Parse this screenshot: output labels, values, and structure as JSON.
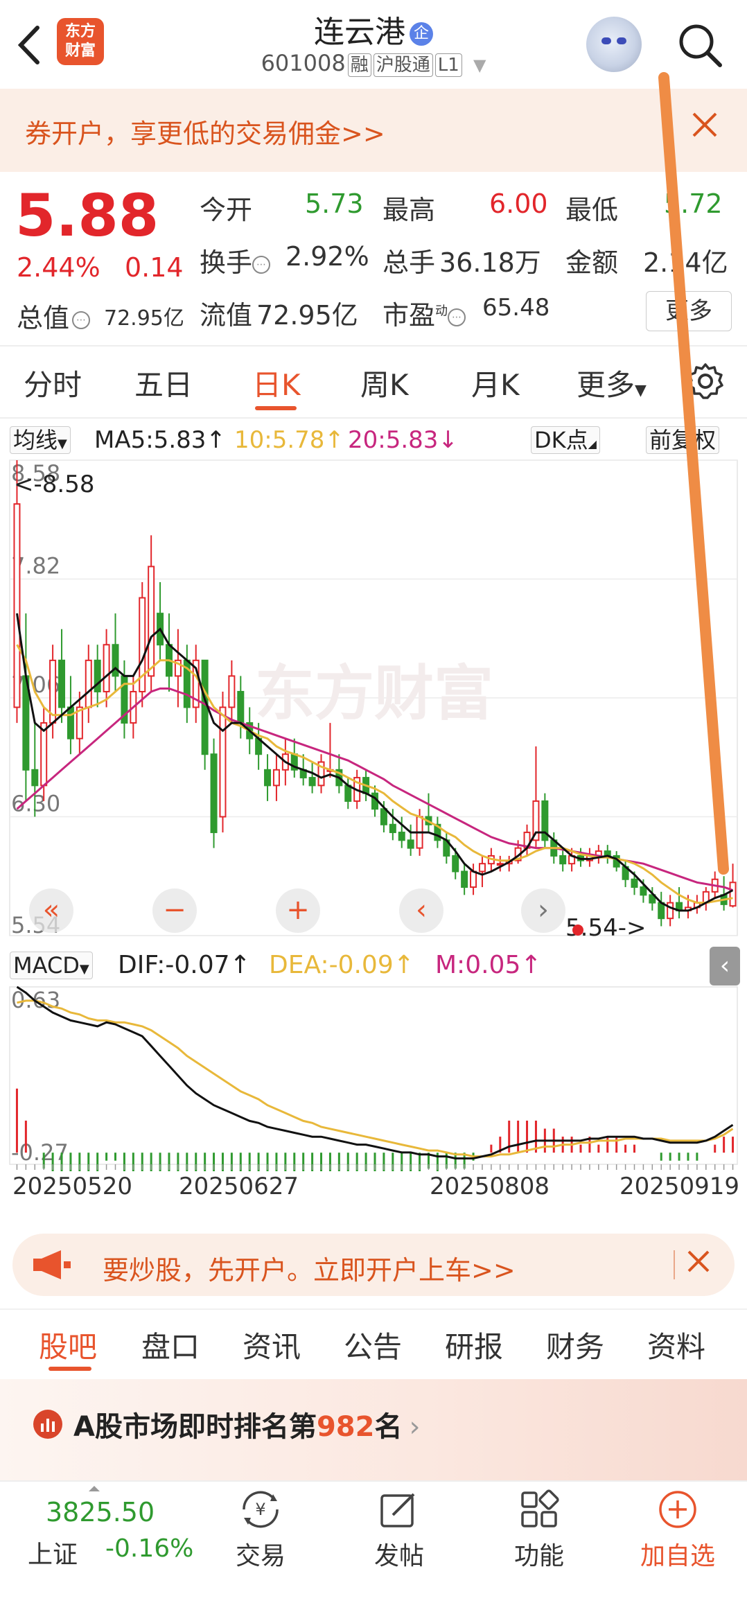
{
  "header": {
    "title": "连云港",
    "badge": "企",
    "code": "601008",
    "tags": [
      "融",
      "沪股通",
      "L1"
    ],
    "logo_text": "东方财富"
  },
  "promo": {
    "text": "券开户，享更低的交易佣金>>"
  },
  "quote": {
    "price": "5.88",
    "change_pct": "2.44%",
    "change": "0.14",
    "market_cap_label": "总值",
    "market_cap": "72.95亿",
    "rows": [
      [
        {
          "label": "今开",
          "value": "5.73",
          "color": "green"
        },
        {
          "label": "最高",
          "value": "6.00",
          "color": "red"
        },
        {
          "label": "最低",
          "value": "5.72",
          "color": "green"
        }
      ],
      [
        {
          "label": "换手",
          "value": "2.92%",
          "color": "dark"
        },
        {
          "label": "总手",
          "value": "36.18万",
          "color": "dark"
        },
        {
          "label": "金额",
          "value": "2.14亿",
          "color": "dark"
        }
      ],
      [
        {
          "label": "流值",
          "value": "72.95亿",
          "color": "dark"
        },
        {
          "label": "市盈",
          "value": "65.48",
          "color": "dark"
        }
      ]
    ],
    "pe_sup": "动",
    "more": "更多"
  },
  "ktabs": [
    "分时",
    "五日",
    "日K",
    "周K",
    "月K",
    "更多"
  ],
  "ktabs_active": 2,
  "ma": {
    "selector": "均线",
    "ma5": "MA5:5.83↑",
    "ma10": "10:5.78↑",
    "ma20": "20:5.83↓",
    "dk": "DK点",
    "fq": "前复权"
  },
  "macd": {
    "selector": "MACD",
    "dif": "DIF:-0.07↑",
    "dea": "DEA:-0.09↑",
    "m": "M:0.05↑"
  },
  "colors": {
    "accent": "#e8542d",
    "up": "#e2262b",
    "down": "#2f9a2f",
    "ma10": "#e8b83a",
    "ma20": "#c7267e",
    "ma5": "#111111"
  },
  "chart_data": [
    {
      "type": "candlestick",
      "title": "日K",
      "ylim": [
        5.54,
        8.58
      ],
      "y_ticks": [
        "8.58",
        "7.82",
        "7.06",
        "6.30",
        "5.54"
      ],
      "high_marker": "<-8.58",
      "low_marker": "5.54->",
      "x_labels": [
        "20250520",
        "20250627",
        "20250808",
        "20250919"
      ],
      "ohlc": [
        [
          7.0,
          8.58,
          6.9,
          8.3
        ],
        [
          7.2,
          7.6,
          6.4,
          6.6
        ],
        [
          6.6,
          6.9,
          6.3,
          6.5
        ],
        [
          6.5,
          7.0,
          6.4,
          6.9
        ],
        [
          6.9,
          7.4,
          6.8,
          7.3
        ],
        [
          7.3,
          7.5,
          6.9,
          7.0
        ],
        [
          7.0,
          7.2,
          6.7,
          6.8
        ],
        [
          6.8,
          7.1,
          6.7,
          7.0
        ],
        [
          7.0,
          7.4,
          6.9,
          7.3
        ],
        [
          7.3,
          7.4,
          7.0,
          7.1
        ],
        [
          7.1,
          7.5,
          7.0,
          7.4
        ],
        [
          7.4,
          7.6,
          7.1,
          7.2
        ],
        [
          7.2,
          7.3,
          6.8,
          6.9
        ],
        [
          6.9,
          7.2,
          6.8,
          7.1
        ],
        [
          7.1,
          7.8,
          7.0,
          7.7
        ],
        [
          7.2,
          8.1,
          7.1,
          7.9
        ],
        [
          7.6,
          7.8,
          7.3,
          7.4
        ],
        [
          7.4,
          7.6,
          7.1,
          7.2
        ],
        [
          7.2,
          7.5,
          7.0,
          7.3
        ],
        [
          7.3,
          7.4,
          6.9,
          7.0
        ],
        [
          7.0,
          7.4,
          6.9,
          7.3
        ],
        [
          7.3,
          7.3,
          6.6,
          6.7
        ],
        [
          6.7,
          6.8,
          6.1,
          6.2
        ],
        [
          6.3,
          7.1,
          6.2,
          7.0
        ],
        [
          7.0,
          7.3,
          6.9,
          7.2
        ],
        [
          7.1,
          7.2,
          6.8,
          6.9
        ],
        [
          6.9,
          7.0,
          6.7,
          6.8
        ],
        [
          6.8,
          6.9,
          6.6,
          6.7
        ],
        [
          6.6,
          6.7,
          6.4,
          6.5
        ],
        [
          6.5,
          6.7,
          6.4,
          6.6
        ],
        [
          6.6,
          6.8,
          6.5,
          6.7
        ],
        [
          6.7,
          6.8,
          6.55,
          6.6
        ],
        [
          6.6,
          6.7,
          6.5,
          6.55
        ],
        [
          6.55,
          6.65,
          6.45,
          6.5
        ],
        [
          6.5,
          6.7,
          6.45,
          6.65
        ],
        [
          6.6,
          6.9,
          6.55,
          6.6
        ],
        [
          6.6,
          6.7,
          6.45,
          6.5
        ],
        [
          6.5,
          6.55,
          6.35,
          6.4
        ],
        [
          6.4,
          6.6,
          6.35,
          6.55
        ],
        [
          6.55,
          6.6,
          6.4,
          6.45
        ],
        [
          6.45,
          6.5,
          6.3,
          6.35
        ],
        [
          6.35,
          6.4,
          6.2,
          6.25
        ],
        [
          6.25,
          6.35,
          6.15,
          6.2
        ],
        [
          6.2,
          6.3,
          6.1,
          6.15
        ],
        [
          6.15,
          6.25,
          6.05,
          6.1
        ],
        [
          6.1,
          6.35,
          6.05,
          6.3
        ],
        [
          6.3,
          6.45,
          6.2,
          6.25
        ],
        [
          6.25,
          6.3,
          6.1,
          6.15
        ],
        [
          6.15,
          6.2,
          6.0,
          6.05
        ],
        [
          6.05,
          6.1,
          5.9,
          5.95
        ],
        [
          5.95,
          6.0,
          5.8,
          5.85
        ],
        [
          5.85,
          6.0,
          5.8,
          5.95
        ],
        [
          5.95,
          6.05,
          5.85,
          6.0
        ],
        [
          6.0,
          6.1,
          5.95,
          6.05
        ],
        [
          6.0,
          6.05,
          5.95,
          6.0
        ],
        [
          6.0,
          6.05,
          5.95,
          6.02
        ],
        [
          6.02,
          6.15,
          6.0,
          6.1
        ],
        [
          6.1,
          6.25,
          6.05,
          6.2
        ],
        [
          6.15,
          6.75,
          6.1,
          6.4
        ],
        [
          6.4,
          6.45,
          6.1,
          6.15
        ],
        [
          6.15,
          6.2,
          6.0,
          6.05
        ],
        [
          6.05,
          6.1,
          5.95,
          6.0
        ],
        [
          6.0,
          6.1,
          5.95,
          6.05
        ],
        [
          6.05,
          6.1,
          5.98,
          6.02
        ],
        [
          6.02,
          6.1,
          5.98,
          6.05
        ],
        [
          6.05,
          6.12,
          6.0,
          6.08
        ],
        [
          6.08,
          6.12,
          6.0,
          6.05
        ],
        [
          6.05,
          6.08,
          5.95,
          5.98
        ],
        [
          5.98,
          6.02,
          5.85,
          5.9
        ],
        [
          5.9,
          5.95,
          5.8,
          5.85
        ],
        [
          5.85,
          5.9,
          5.75,
          5.8
        ],
        [
          5.8,
          5.85,
          5.7,
          5.75
        ],
        [
          5.75,
          5.82,
          5.6,
          5.65
        ],
        [
          5.65,
          5.8,
          5.6,
          5.75
        ],
        [
          5.75,
          5.85,
          5.65,
          5.7
        ],
        [
          5.7,
          5.8,
          5.65,
          5.72
        ],
        [
          5.72,
          5.8,
          5.68,
          5.75
        ],
        [
          5.75,
          5.85,
          5.7,
          5.82
        ],
        [
          5.82,
          5.95,
          5.78,
          5.9
        ],
        [
          5.8,
          5.92,
          5.7,
          5.74
        ],
        [
          5.73,
          6.0,
          5.72,
          5.88
        ]
      ],
      "ma5": [
        7.6,
        7.2,
        6.9,
        6.85,
        6.9,
        6.95,
        7.0,
        7.05,
        7.1,
        7.15,
        7.2,
        7.25,
        7.2,
        7.2,
        7.3,
        7.45,
        7.5,
        7.4,
        7.35,
        7.3,
        7.25,
        7.05,
        6.9,
        6.85,
        6.9,
        6.9,
        6.85,
        6.8,
        6.75,
        6.7,
        6.65,
        6.62,
        6.6,
        6.58,
        6.55,
        6.57,
        6.55,
        6.5,
        6.47,
        6.45,
        6.42,
        6.36,
        6.3,
        6.25,
        6.2,
        6.2,
        6.2,
        6.18,
        6.15,
        6.08,
        6.0,
        5.95,
        5.93,
        5.95,
        5.98,
        6.01,
        6.05,
        6.1,
        6.2,
        6.2,
        6.15,
        6.1,
        6.05,
        6.03,
        6.03,
        6.04,
        6.05,
        6.03,
        5.98,
        5.93,
        5.87,
        5.81,
        5.75,
        5.72,
        5.7,
        5.7,
        5.72,
        5.75,
        5.78,
        5.8,
        5.83
      ],
      "ma10": [
        7.4,
        7.3,
        7.1,
        7.0,
        6.95,
        6.95,
        6.95,
        6.98,
        7.0,
        7.02,
        7.05,
        7.1,
        7.15,
        7.15,
        7.2,
        7.25,
        7.3,
        7.3,
        7.28,
        7.25,
        7.2,
        7.1,
        7.0,
        6.95,
        6.9,
        6.88,
        6.85,
        6.82,
        6.8,
        6.75,
        6.72,
        6.7,
        6.68,
        6.65,
        6.62,
        6.6,
        6.58,
        6.55,
        6.52,
        6.5,
        6.48,
        6.45,
        6.4,
        6.36,
        6.32,
        6.3,
        6.27,
        6.24,
        6.2,
        6.17,
        6.12,
        6.08,
        6.05,
        6.03,
        6.02,
        6.02,
        6.03,
        6.05,
        6.08,
        6.1,
        6.1,
        6.1,
        6.08,
        6.06,
        6.05,
        6.04,
        6.04,
        6.03,
        6.02,
        6.0,
        5.97,
        5.93,
        5.88,
        5.84,
        5.8,
        5.77,
        5.75,
        5.75,
        5.76,
        5.77,
        5.78
      ],
      "ma20": [
        6.35,
        6.4,
        6.45,
        6.5,
        6.55,
        6.6,
        6.65,
        6.7,
        6.75,
        6.8,
        6.85,
        6.9,
        6.95,
        7.0,
        7.05,
        7.1,
        7.12,
        7.12,
        7.1,
        7.08,
        7.05,
        7.02,
        6.98,
        6.95,
        6.92,
        6.9,
        6.88,
        6.86,
        6.84,
        6.82,
        6.8,
        6.78,
        6.76,
        6.74,
        6.72,
        6.7,
        6.68,
        6.66,
        6.63,
        6.6,
        6.57,
        6.54,
        6.5,
        6.47,
        6.44,
        6.41,
        6.38,
        6.35,
        6.32,
        6.29,
        6.26,
        6.23,
        6.2,
        6.17,
        6.15,
        6.13,
        6.12,
        6.11,
        6.1,
        6.1,
        6.1,
        6.09,
        6.08,
        6.07,
        6.06,
        6.05,
        6.04,
        6.03,
        6.02,
        6.01,
        6.0,
        5.98,
        5.96,
        5.94,
        5.92,
        5.9,
        5.88,
        5.87,
        5.86,
        5.85,
        5.83
      ]
    },
    {
      "type": "macd",
      "ylim": [
        -0.27,
        0.63
      ],
      "y_ticks": [
        "0.63",
        "-0.27"
      ],
      "dif": [
        0.63,
        0.6,
        0.56,
        0.53,
        0.5,
        0.48,
        0.46,
        0.45,
        0.44,
        0.43,
        0.45,
        0.44,
        0.42,
        0.4,
        0.38,
        0.33,
        0.28,
        0.23,
        0.18,
        0.13,
        0.09,
        0.06,
        0.03,
        0.01,
        -0.01,
        -0.03,
        -0.05,
        -0.06,
        -0.08,
        -0.09,
        -0.1,
        -0.11,
        -0.12,
        -0.13,
        -0.13,
        -0.14,
        -0.15,
        -0.16,
        -0.17,
        -0.17,
        -0.18,
        -0.19,
        -0.2,
        -0.21,
        -0.21,
        -0.22,
        -0.22,
        -0.23,
        -0.23,
        -0.24,
        -0.24,
        -0.24,
        -0.23,
        -0.22,
        -0.2,
        -0.18,
        -0.17,
        -0.16,
        -0.15,
        -0.15,
        -0.15,
        -0.15,
        -0.15,
        -0.15,
        -0.14,
        -0.14,
        -0.13,
        -0.13,
        -0.13,
        -0.13,
        -0.14,
        -0.14,
        -0.15,
        -0.16,
        -0.16,
        -0.16,
        -0.16,
        -0.15,
        -0.13,
        -0.1,
        -0.07
      ],
      "dea": [
        0.55,
        0.56,
        0.56,
        0.55,
        0.53,
        0.52,
        0.5,
        0.49,
        0.47,
        0.46,
        0.46,
        0.45,
        0.45,
        0.44,
        0.43,
        0.41,
        0.38,
        0.35,
        0.32,
        0.28,
        0.25,
        0.22,
        0.19,
        0.16,
        0.13,
        0.1,
        0.08,
        0.06,
        0.03,
        0.01,
        -0.01,
        -0.03,
        -0.05,
        -0.06,
        -0.08,
        -0.09,
        -0.1,
        -0.11,
        -0.12,
        -0.13,
        -0.14,
        -0.15,
        -0.16,
        -0.17,
        -0.18,
        -0.19,
        -0.2,
        -0.2,
        -0.21,
        -0.22,
        -0.22,
        -0.23,
        -0.23,
        -0.23,
        -0.22,
        -0.22,
        -0.21,
        -0.2,
        -0.19,
        -0.18,
        -0.18,
        -0.17,
        -0.17,
        -0.16,
        -0.16,
        -0.15,
        -0.15,
        -0.15,
        -0.14,
        -0.14,
        -0.14,
        -0.14,
        -0.14,
        -0.15,
        -0.15,
        -0.15,
        -0.15,
        -0.15,
        -0.14,
        -0.12,
        -0.09
      ]
    }
  ],
  "chart_controls": [
    "«",
    "−",
    "+",
    "‹",
    "›"
  ],
  "watermark": "东方财富",
  "account_bar": {
    "text": "要炒股，先开户。立即开户上车>>"
  },
  "btabs": [
    "股吧",
    "盘口",
    "资讯",
    "公告",
    "研报",
    "财务",
    "资料"
  ],
  "btabs_active": 0,
  "ranking": {
    "prefix": "A股市场即时排名第",
    "rank": "982",
    "suffix": "名"
  },
  "bottom_nav": {
    "index_value": "3825.50",
    "index_name": "上证",
    "index_pct": "-0.16%",
    "items": [
      "交易",
      "发帖",
      "功能",
      "加自选"
    ]
  }
}
